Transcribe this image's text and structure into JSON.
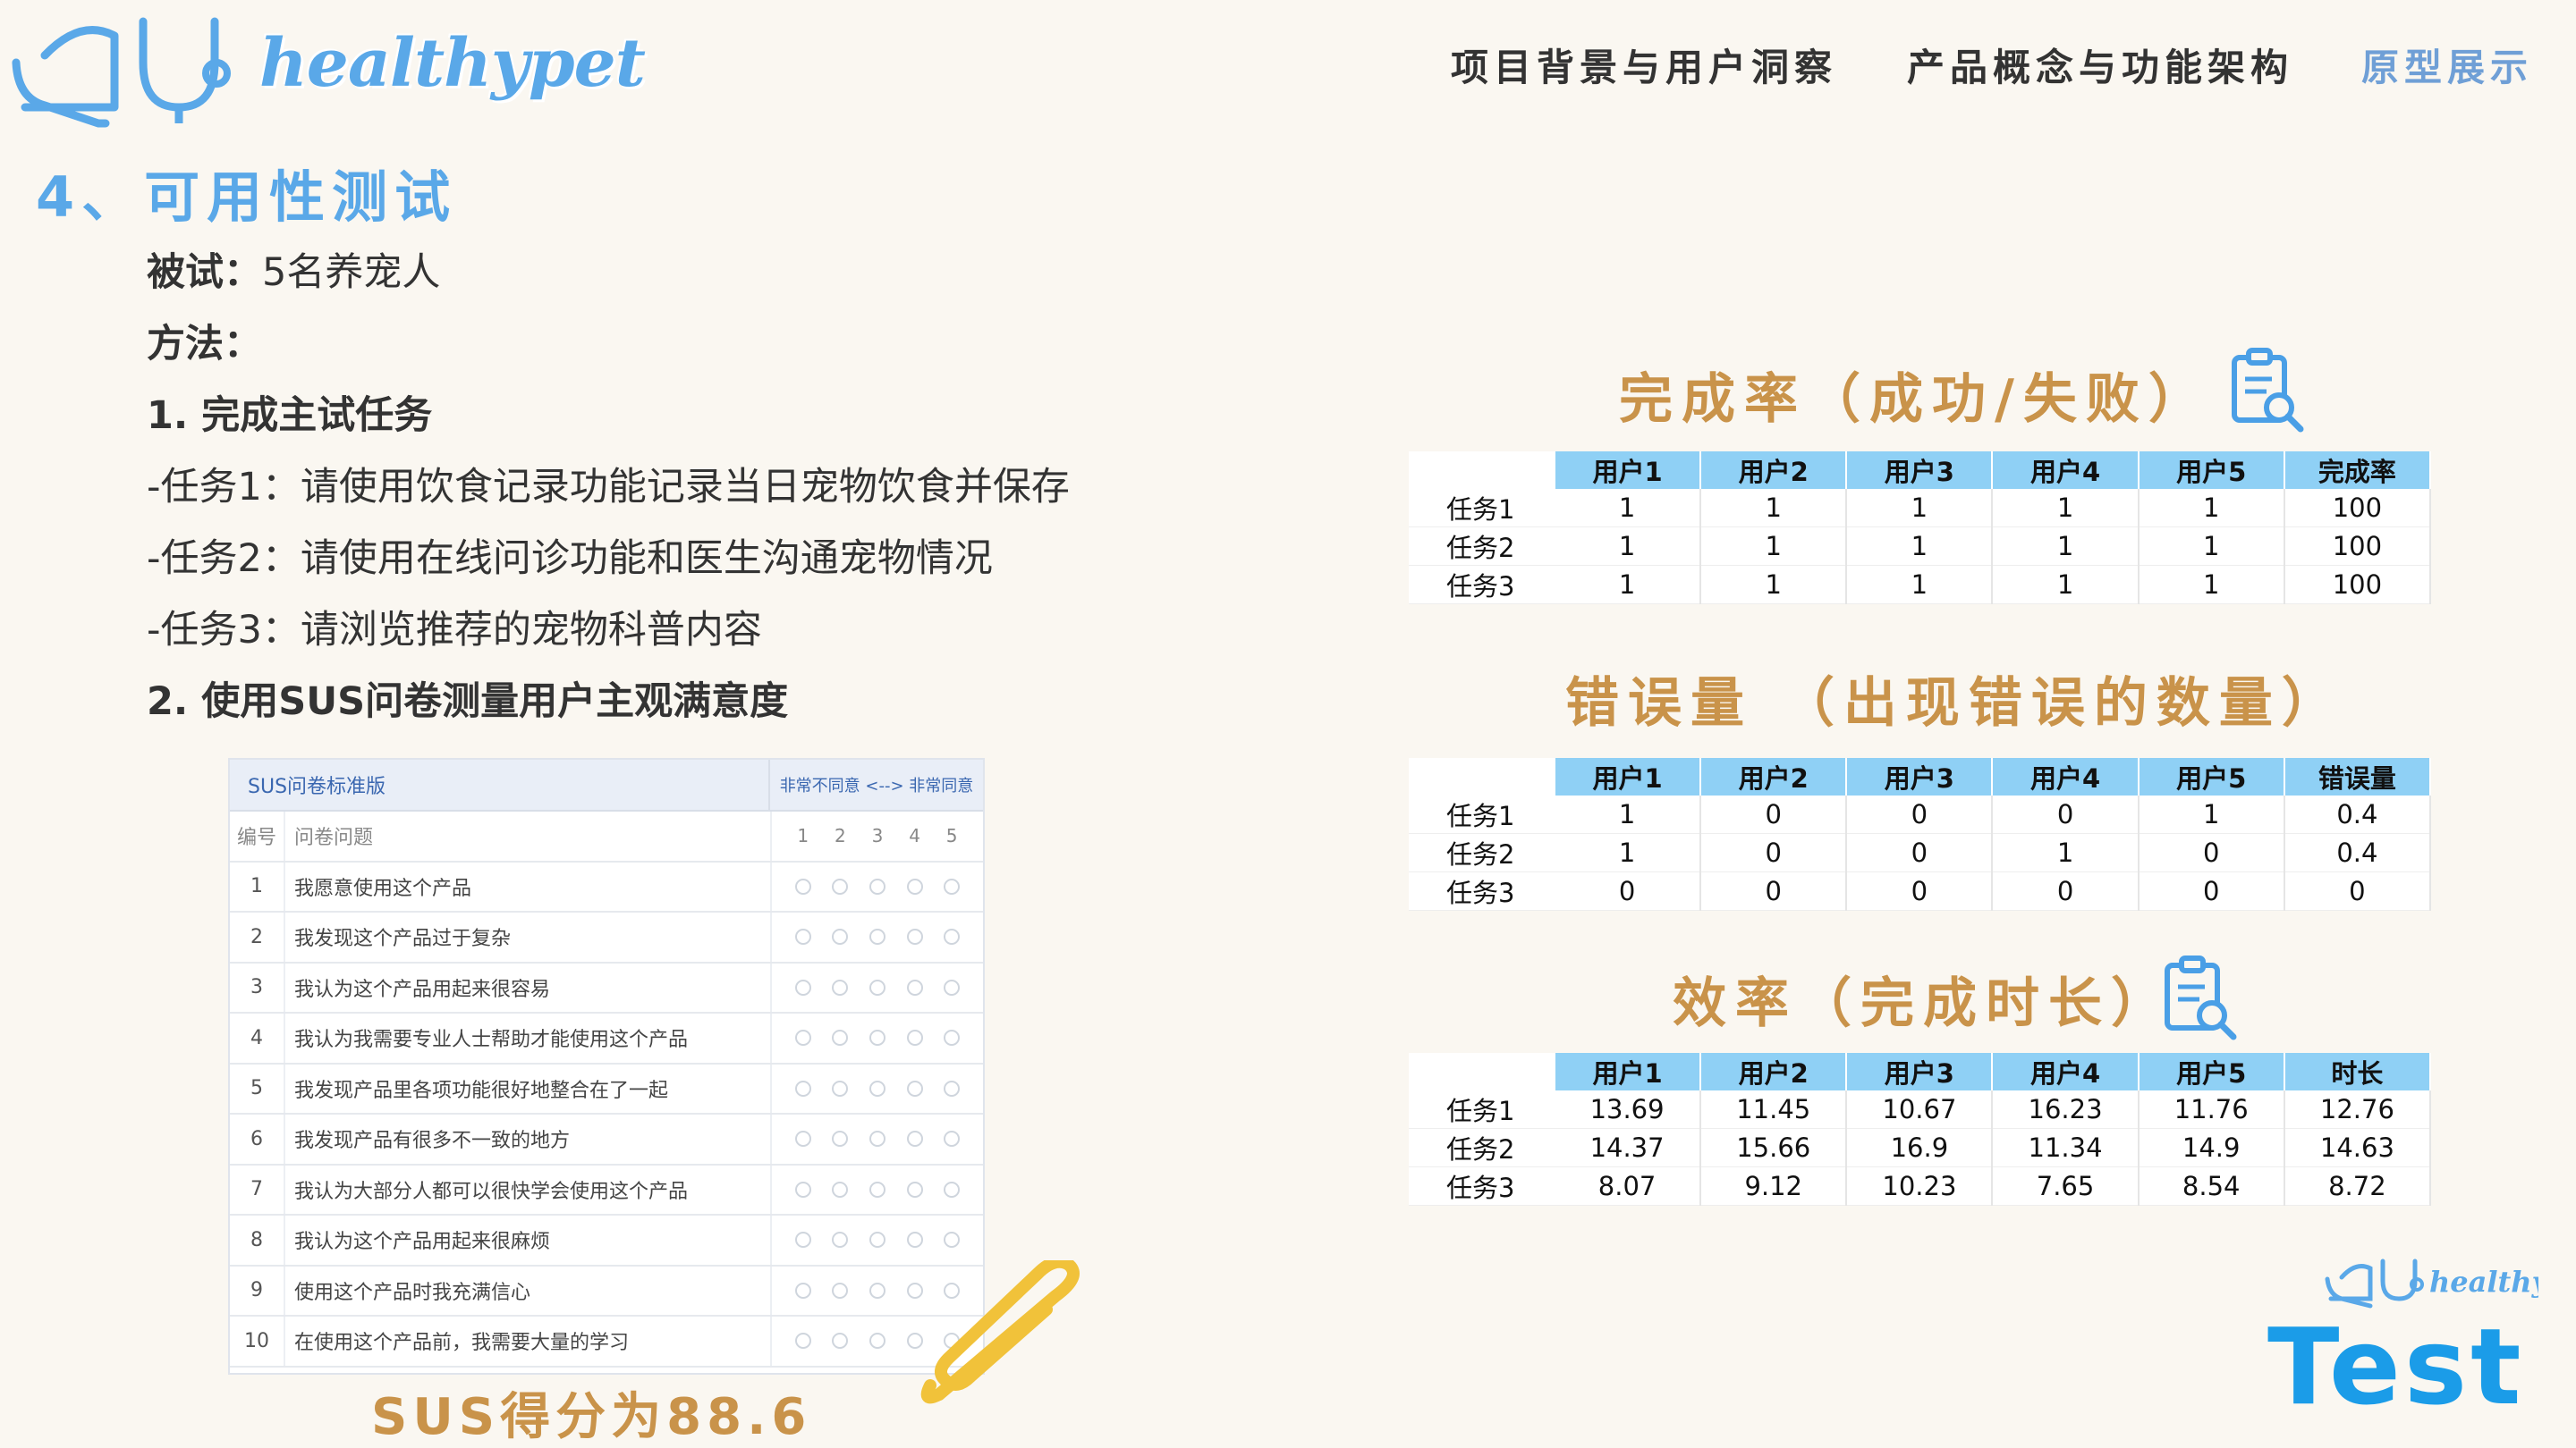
{
  "brand": {
    "logo_text": "healthypet",
    "bottom_text": "Test"
  },
  "nav": [
    {
      "label": "项目背景与用户洞察"
    },
    {
      "label": "产品概念与功能架构"
    },
    {
      "label": "原型展示"
    }
  ],
  "heading": "4、可用性测试",
  "body": {
    "subjects_label": "被试：",
    "subjects_value": "5名养宠人",
    "method_label": "方法：",
    "step1": "1. 完成主试任务",
    "task1": "-任务1：请使用饮食记录功能记录当日宠物饮食并保存",
    "task2": "-任务2：请使用在线问诊功能和医生沟通宠物情况",
    "task3": "-任务3：请浏览推荐的宠物科普内容",
    "step2": "2. 使用SUS问卷测量用户主观满意度"
  },
  "sus": {
    "title": "SUS问卷标准版",
    "scale_label": "非常不同意 <--> 非常同意",
    "col_num": "编号",
    "col_q": "问卷问题",
    "scale": [
      "1",
      "2",
      "3",
      "4",
      "5"
    ],
    "questions": [
      {
        "num": "1",
        "text": "我愿意使用这个产品"
      },
      {
        "num": "2",
        "text": "我发现这个产品过于复杂"
      },
      {
        "num": "3",
        "text": "我认为这个产品用起来很容易"
      },
      {
        "num": "4",
        "text": "我认为我需要专业人士帮助才能使用这个产品"
      },
      {
        "num": "5",
        "text": "我发现产品里各项功能很好地整合在了一起"
      },
      {
        "num": "6",
        "text": "我发现产品有很多不一致的地方"
      },
      {
        "num": "7",
        "text": "我认为大部分人都可以很快学会使用这个产品"
      },
      {
        "num": "8",
        "text": "我认为这个产品用起来很麻烦"
      },
      {
        "num": "9",
        "text": "使用这个产品时我充满信心"
      },
      {
        "num": "10",
        "text": "在使用这个产品前，我需要大量的学习"
      }
    ],
    "score": "SUS得分为88.6"
  },
  "completion": {
    "title": "完成率（成功/失败）",
    "columns": [
      "用户1",
      "用户2",
      "用户3",
      "用户4",
      "用户5",
      "完成率"
    ],
    "rows": [
      {
        "label": "任务1",
        "cells": [
          "1",
          "1",
          "1",
          "1",
          "1",
          "100"
        ]
      },
      {
        "label": "任务2",
        "cells": [
          "1",
          "1",
          "1",
          "1",
          "1",
          "100"
        ]
      },
      {
        "label": "任务3",
        "cells": [
          "1",
          "1",
          "1",
          "1",
          "1",
          "100"
        ]
      }
    ]
  },
  "errors": {
    "title": "错误量 （出现错误的数量）",
    "columns": [
      "用户1",
      "用户2",
      "用户3",
      "用户4",
      "用户5",
      "错误量"
    ],
    "rows": [
      {
        "label": "任务1",
        "cells": [
          "1",
          "0",
          "0",
          "0",
          "1",
          "0.4"
        ]
      },
      {
        "label": "任务2",
        "cells": [
          "1",
          "0",
          "0",
          "1",
          "0",
          "0.4"
        ]
      },
      {
        "label": "任务3",
        "cells": [
          "0",
          "0",
          "0",
          "0",
          "0",
          "0"
        ]
      }
    ]
  },
  "efficiency": {
    "title": "效率（完成时长）",
    "columns": [
      "用户1",
      "用户2",
      "用户3",
      "用户4",
      "用户5",
      "时长"
    ],
    "rows": [
      {
        "label": "任务1",
        "cells": [
          "13.69",
          "11.45",
          "10.67",
          "16.23",
          "11.76",
          "12.76"
        ]
      },
      {
        "label": "任务2",
        "cells": [
          "14.37",
          "15.66",
          "16.9",
          "11.34",
          "14.9",
          "14.63"
        ]
      },
      {
        "label": "任务3",
        "cells": [
          "8.07",
          "9.12",
          "10.23",
          "7.65",
          "8.54",
          "8.72"
        ]
      }
    ]
  },
  "colors": {
    "accent_blue": "#5aa8e8",
    "table_header": "#8fd0f5",
    "title_gold": "#c9934a",
    "brand_blue": "#1b9ce8"
  },
  "icons": [
    "stethoscope-logo-icon",
    "clipboard-search-icon",
    "paperclip-icon"
  ]
}
